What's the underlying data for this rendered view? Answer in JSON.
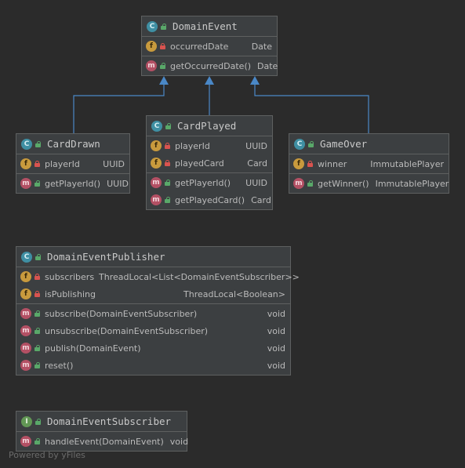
{
  "colors": {
    "background": "#2b2b2b",
    "box": "#3c3f41",
    "border": "#5e6060",
    "arrow": "#4a88c7"
  },
  "classes": {
    "domain_event": {
      "name": "DomainEvent",
      "kind": "C",
      "fields": [
        {
          "name": "occurredDate",
          "type": "Date"
        }
      ],
      "methods": [
        {
          "name": "getOccurredDate()",
          "type": "Date"
        }
      ]
    },
    "card_drawn": {
      "name": "CardDrawn",
      "kind": "C",
      "fields": [
        {
          "name": "playerId",
          "type": "UUID"
        }
      ],
      "methods": [
        {
          "name": "getPlayerId()",
          "type": "UUID"
        }
      ]
    },
    "card_played": {
      "name": "CardPlayed",
      "kind": "C",
      "fields": [
        {
          "name": "playerId",
          "type": "UUID"
        },
        {
          "name": "playedCard",
          "type": "Card"
        }
      ],
      "methods": [
        {
          "name": "getPlayerId()",
          "type": "UUID"
        },
        {
          "name": "getPlayedCard()",
          "type": "Card"
        }
      ]
    },
    "game_over": {
      "name": "GameOver",
      "kind": "C",
      "fields": [
        {
          "name": "winner",
          "type": "ImmutablePlayer"
        }
      ],
      "methods": [
        {
          "name": "getWinner()",
          "type": "ImmutablePlayer"
        }
      ]
    },
    "publisher": {
      "name": "DomainEventPublisher",
      "kind": "C",
      "fields": [
        {
          "name": "subscribers",
          "type": "ThreadLocal<List<DomainEventSubscriber>>"
        },
        {
          "name": "isPublishing",
          "type": "ThreadLocal<Boolean>"
        }
      ],
      "methods": [
        {
          "name": "subscribe(DomainEventSubscriber)",
          "type": "void"
        },
        {
          "name": "unsubscribe(DomainEventSubscriber)",
          "type": "void"
        },
        {
          "name": "publish(DomainEvent)",
          "type": "void"
        },
        {
          "name": "reset()",
          "type": "void"
        }
      ]
    },
    "subscriber": {
      "name": "DomainEventSubscriber",
      "kind": "I",
      "methods": [
        {
          "name": "handleEvent(DomainEvent)",
          "type": "void"
        }
      ]
    }
  },
  "footer": "Powered by yFiles"
}
